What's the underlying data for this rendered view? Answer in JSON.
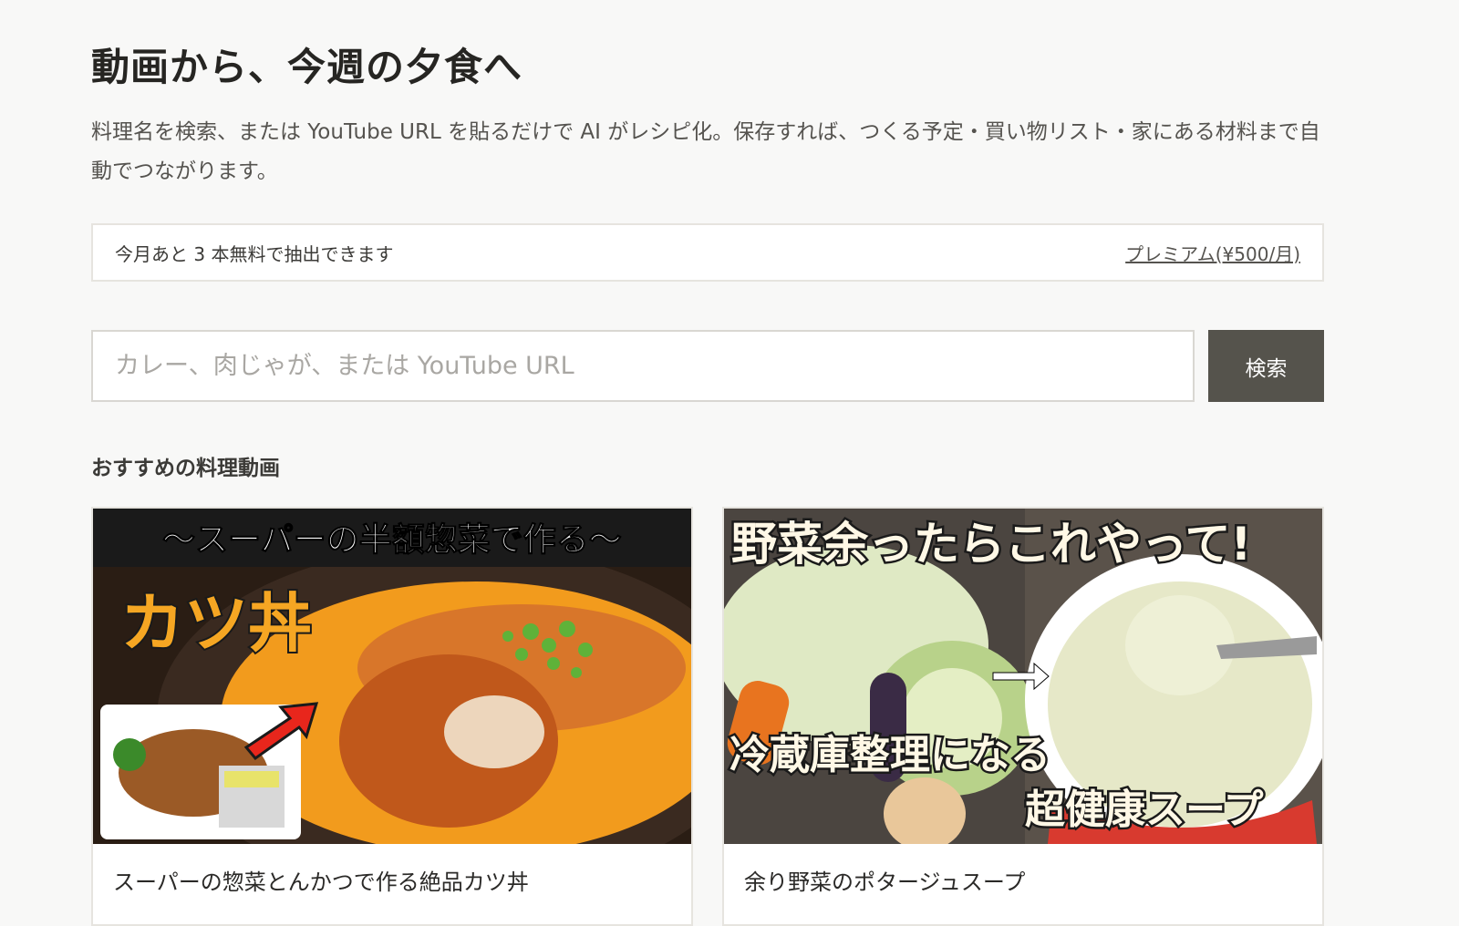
{
  "header": {
    "title": "動画から、今週の夕食へ",
    "lead": "料理名を検索、または YouTube URL を貼るだけで AI がレシピ化。保存すれば、つくる予定・買い物リスト・家にある材料まで自動でつながります。"
  },
  "quota": {
    "text": "今月あと 3 本無料で抽出できます",
    "premium_link": "プレミアム(¥500/月)"
  },
  "search": {
    "placeholder": "カレー、肉じゃが、または YouTube URL",
    "value": "",
    "button_label": "検索"
  },
  "recommended": {
    "heading": "おすすめの料理動画",
    "videos": [
      {
        "title": "スーパーの惣菜とんかつで作る絶品カツ丼",
        "thumb_top_text": "〜スーパーの半額惣菜で作る〜",
        "thumb_main_text": "カツ丼",
        "thumb_colors": {
          "banner": "#1a1a1a",
          "main_text": "#f5a623",
          "egg": "#f29b1d",
          "cutlet": "#c0581b",
          "arrow": "#e8261c"
        }
      },
      {
        "title": "余り野菜のポタージュスープ",
        "thumb_top_text": "野菜余ったらこれやって!",
        "thumb_mid_text": "冷蔵庫整理になる",
        "thumb_bottom_text": "超健康スープ",
        "thumb_colors": {
          "bg": "#4b4540",
          "cabbage": "#dfe9c4",
          "carrot": "#e8741f",
          "soup": "#e6e8c8",
          "bowl": "#d83a2f",
          "text": "#fff8e6"
        }
      }
    ]
  }
}
